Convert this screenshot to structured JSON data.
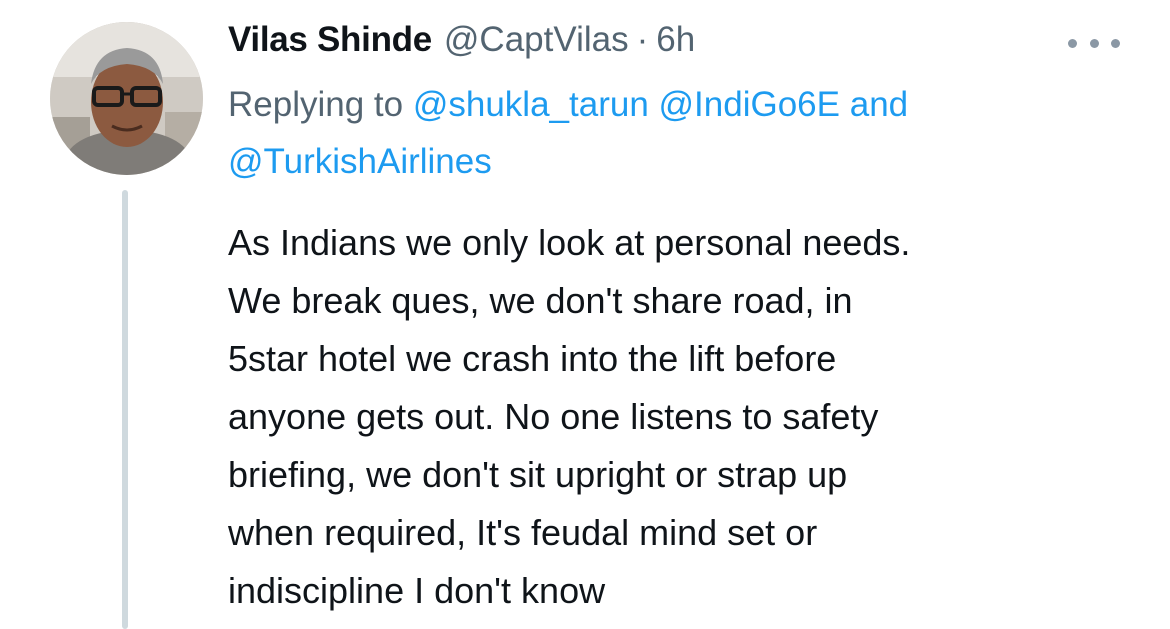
{
  "tweet": {
    "author_name": "Vilas Shinde",
    "author_handle": "@CaptVilas",
    "separator": "·",
    "timestamp": "6h",
    "more_icon": "more-horizontal-icon",
    "reply": {
      "prefix": "Replying to",
      "mentions": [
        "@shukla_tarun",
        "@IndiGo6E",
        "@TurkishAirlines"
      ],
      "conjunction": "and"
    },
    "body_lines": [
      "As Indians we only look at personal needs.",
      "We break ques, we don't share road, in",
      "5star hotel we crash into the lift before",
      "anyone gets out. No one listens to safety",
      "briefing, we don't sit upright or strap up",
      "when required, It's feudal mind set or",
      "indiscipline I don't know"
    ]
  },
  "colors": {
    "text_primary": "#0f1419",
    "text_secondary": "#536471",
    "link": "#1d9bf0",
    "thread_line": "#cfd9de"
  }
}
